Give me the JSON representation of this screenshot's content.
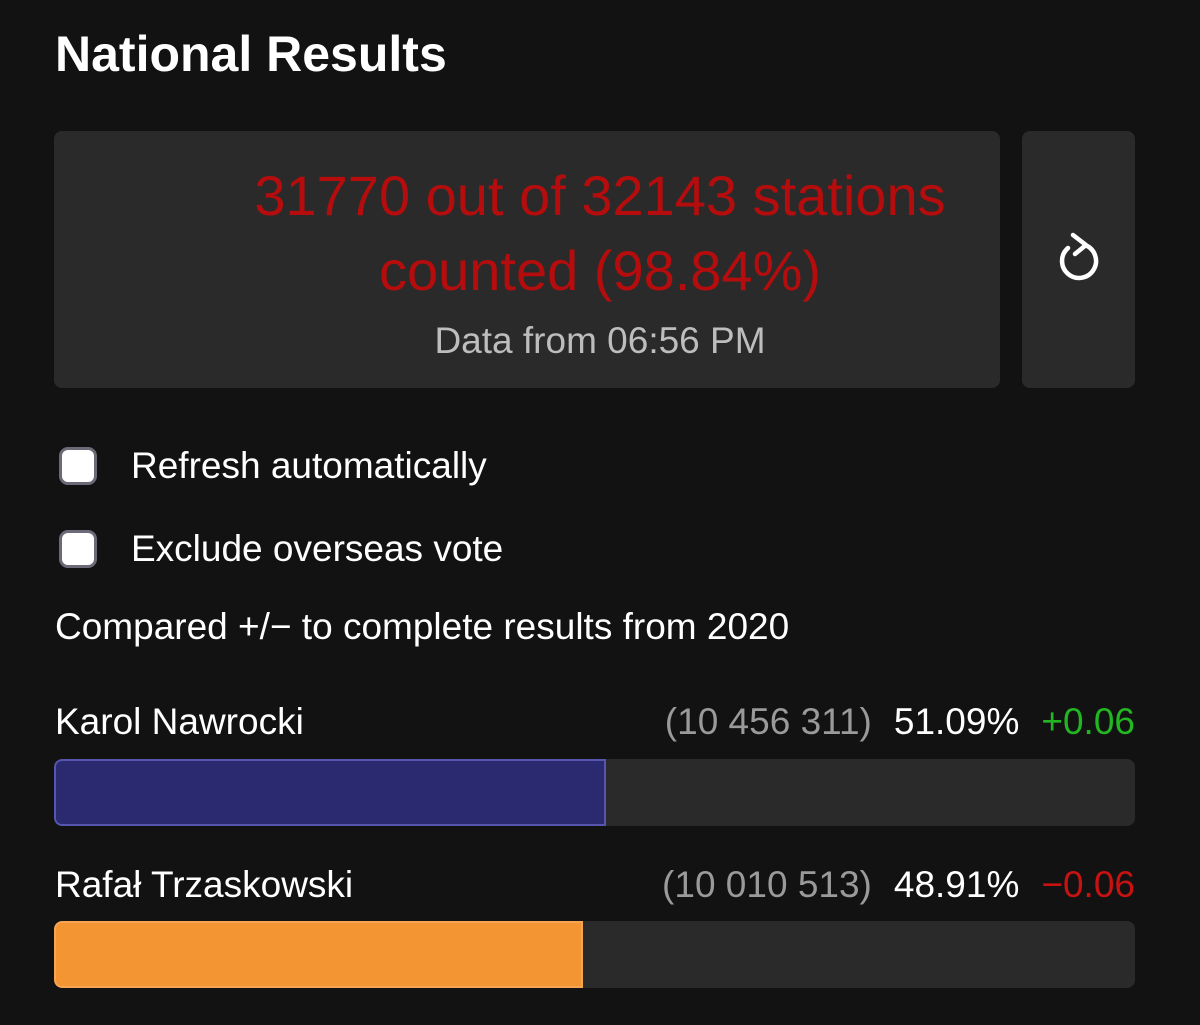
{
  "header": {
    "title": "National Results"
  },
  "status": {
    "headline": "31770 out of 32143 stations counted (98.84%)",
    "subline": "Data from 06:56 PM",
    "headline_color": "#b50d0d"
  },
  "refresh_button": {
    "icon": "refresh-icon"
  },
  "options": [
    {
      "label": "Refresh automatically",
      "checked": false
    },
    {
      "label": "Exclude overseas vote",
      "checked": false
    }
  ],
  "comparison_note": "Compared +/− to complete results from 2020",
  "candidates": [
    {
      "name": "Karol Nawrocki",
      "votes": "(10 456 311)",
      "percent": "51.09%",
      "diff": "+0.06",
      "share": 51.09,
      "bar_color": "#2b2a70",
      "bar_border": "#5656b0"
    },
    {
      "name": "Rafał Trzaskowski",
      "votes": "(10 010 513)",
      "percent": "48.91%",
      "diff": "−0.06",
      "share": 48.91,
      "bar_color": "#f39533",
      "bar_border": "#f7a552"
    }
  ],
  "colors": {
    "background": "#121212",
    "card": "#2a2a2a",
    "positive": "#22b622",
    "negative": "#c81212"
  }
}
